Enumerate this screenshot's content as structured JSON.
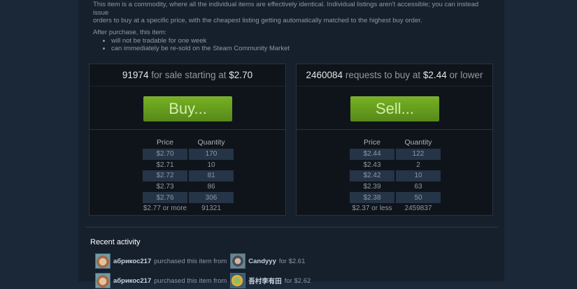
{
  "description": {
    "line1": "This item is a commodity, where all the individual items are effectively identical. Individual listings aren't accessible; you can instead issue",
    "line2": "orders to buy at a specific price, with the cheapest listing getting automatically matched to the highest buy order."
  },
  "after_purchase": {
    "heading": "After purchase, this item:",
    "items": [
      "will not be tradable for one week",
      "can immediately be re-sold on the Steam Community Market"
    ]
  },
  "sell_box": {
    "count": "91974",
    "mid_text": "for sale starting at",
    "price": "$2.70",
    "button_label": "Buy...",
    "col_price": "Price",
    "col_quantity": "Quantity",
    "rows": [
      {
        "price": "$2.70",
        "qty": "170"
      },
      {
        "price": "$2.71",
        "qty": "10"
      },
      {
        "price": "$2.72",
        "qty": "81"
      },
      {
        "price": "$2.73",
        "qty": "86"
      },
      {
        "price": "$2.76",
        "qty": "306"
      },
      {
        "price": "$2.77 or more",
        "qty": "91321"
      }
    ]
  },
  "buy_box": {
    "count": "2460084",
    "mid_text": "requests to buy at",
    "price": "$2.44",
    "tail_text": "or lower",
    "button_label": "Sell...",
    "col_price": "Price",
    "col_quantity": "Quantity",
    "rows": [
      {
        "price": "$2.44",
        "qty": "122"
      },
      {
        "price": "$2.43",
        "qty": "2"
      },
      {
        "price": "$2.42",
        "qty": "10"
      },
      {
        "price": "$2.39",
        "qty": "63"
      },
      {
        "price": "$2.38",
        "qty": "50"
      },
      {
        "price": "$2.37 or less",
        "qty": "2459837"
      }
    ]
  },
  "recent": {
    "title": "Recent activity",
    "items": [
      {
        "buyer": "абрикос217",
        "action": "purchased this item from",
        "seller": "Candyyy",
        "price_text": "for $2.61"
      },
      {
        "buyer": "абрикос217",
        "action": "purchased this item from",
        "seller": "吾村李有田",
        "price_text": "for $2.62"
      }
    ]
  },
  "colors": {
    "background": "#1b2838",
    "button_green": "#75b022",
    "text_muted": "#8f98a0"
  }
}
